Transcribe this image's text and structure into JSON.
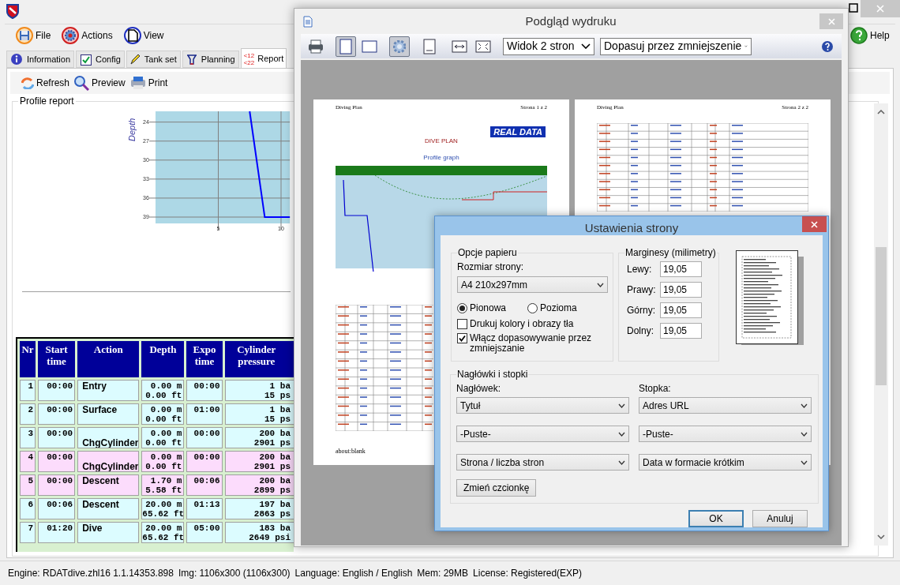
{
  "main_window": {
    "menu": [
      {
        "label": "File"
      },
      {
        "label": "Actions"
      },
      {
        "label": "View"
      },
      {
        "label": "Help"
      }
    ],
    "tabs": [
      {
        "label": "Information",
        "selected": false
      },
      {
        "label": "Config",
        "selected": false
      },
      {
        "label": "Tank set",
        "selected": false
      },
      {
        "label": "Planning",
        "selected": false
      },
      {
        "label": "Report",
        "selected": true,
        "badge_lines": [
          "<12",
          "<22"
        ]
      }
    ],
    "toolbar": [
      "Refresh",
      "Preview",
      "Print"
    ],
    "group_title": "Profile report",
    "chart": {
      "chart_data": {
        "type": "line",
        "ylabel": "Depth",
        "x": [
          7.5,
          8.7,
          10.7
        ],
        "series": [
          {
            "color": "#0000ff",
            "values": [
              22.3,
              39,
              39
            ]
          }
        ],
        "xlim": [
          0,
          10.7
        ],
        "ylim": [
          40,
          22.3
        ],
        "xticks": [
          5,
          10
        ],
        "yticks": [
          24,
          27,
          30,
          33,
          36,
          39
        ],
        "grid": true
      }
    },
    "table": {
      "columns": [
        "Nr",
        "Start time",
        "Action",
        "Depth",
        "Expo time",
        "Cylinder pressure"
      ],
      "rows": [
        {
          "cells": [
            "1",
            "00:00",
            "Entry",
            "0.00 m\n0.00 ft",
            "00:00",
            "1 ba\n15 ps"
          ],
          "highlighted": false
        },
        {
          "cells": [
            "2",
            "00:00",
            "Surface",
            "0.00 m\n0.00 ft",
            "01:00",
            "1 ba\n15 ps"
          ],
          "highlighted": false
        },
        {
          "cells": [
            "3",
            "00:00",
            "\nChgCylinder",
            "0.00 m\n0.00 ft",
            "00:00",
            "200 ba\n2901 ps"
          ],
          "highlighted": false
        },
        {
          "cells": [
            "4",
            "00:00",
            "\nChgCylinder",
            "0.00 m\n0.00 ft",
            "00:00",
            "200 ba\n2901 ps"
          ],
          "highlighted": true
        },
        {
          "cells": [
            "5",
            "00:00",
            "Descent",
            "1.70 m\n5.58 ft",
            "00:06",
            "200 ba\n2899 ps"
          ],
          "highlighted": true
        },
        {
          "cells": [
            "6",
            "00:06",
            "Descent",
            "20.00 m\n65.62 ft",
            "01:13",
            "197 ba\n2863 ps"
          ],
          "highlighted": false
        },
        {
          "cells": [
            "7",
            "01:20",
            "Dive",
            "20.00 m\n65.62 ft",
            "05:00",
            "183 ba\n2649 psi"
          ],
          "highlighted": false
        }
      ]
    },
    "status_bar": [
      "Engine: RDATdive.zhl16 1.1.14353.898",
      "Img: 1106x300 (1106x300)",
      "Language: English / English",
      "Mem: 29MB",
      "License: Registered(EXP)"
    ]
  },
  "preview_window": {
    "title": "Podgląd wydruku",
    "toolbar_buttons": [
      {
        "pressed": false
      },
      {
        "pressed": true
      },
      {
        "pressed": false
      },
      {
        "pressed": true
      },
      {
        "pressed": false
      },
      {
        "pressed": false
      },
      {
        "pressed": false
      }
    ],
    "view_select": "Widok 2 stron",
    "fit_select": "Dopasuj przez zmniejszenie",
    "pages": [
      {
        "header_left": "Diving Plan",
        "header_right": "Strona 1 z 2",
        "logo": "REAL DATA",
        "heading": "DIVE PLAN",
        "graph_title": "Profile graph",
        "footer": "about:blank"
      },
      {
        "header_left": "Diving Plan",
        "header_right": "Strona 2 z 2"
      }
    ]
  },
  "page_setup_dialog": {
    "title": "Ustawienia strony",
    "paper_group": "Opcje papieru",
    "size_label": "Rozmiar strony:",
    "size_value": "A4 210x297mm",
    "orientation": [
      {
        "label": "Pionowa",
        "selected": true
      },
      {
        "label": "Pozioma",
        "selected": false
      }
    ],
    "checkboxes": [
      {
        "label": "Drukuj kolory i obrazy tła",
        "checked": false
      },
      {
        "label": "Włącz dopasowywanie przez zmniejszanie",
        "checked": true
      }
    ],
    "margins_group": "Marginesy (milimetry)",
    "margins": [
      {
        "label": "Lewy:",
        "value": "19,05"
      },
      {
        "label": "Prawy:",
        "value": "19,05"
      },
      {
        "label": "Górny:",
        "value": "19,05"
      },
      {
        "label": "Dolny:",
        "value": "19,05"
      }
    ],
    "hf_group": "Nagłówki i stopki",
    "header_label": "Nagłówek:",
    "footer_label": "Stopka:",
    "header_selects": [
      "Tytuł",
      "-Puste-",
      "Strona / liczba stron"
    ],
    "footer_selects": [
      "Adres URL",
      "-Puste-",
      "Data w formacie krótkim"
    ],
    "font_button": "Zmień czcionkę",
    "buttons": [
      "OK",
      "Anuluj"
    ]
  }
}
